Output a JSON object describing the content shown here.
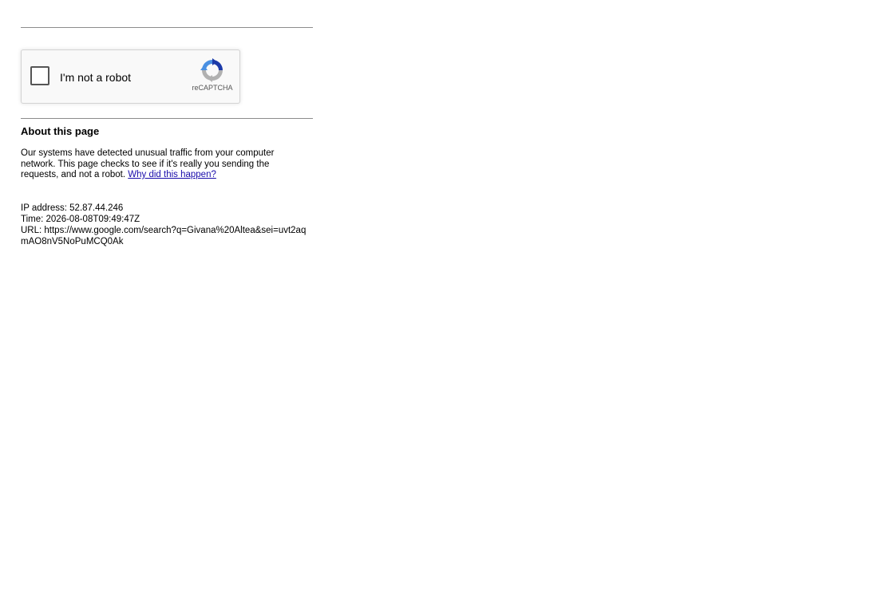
{
  "captcha": {
    "label": "I'm not a robot",
    "brand": "reCAPTCHA",
    "checked": false
  },
  "about": {
    "title": "About this page",
    "body": "Our systems have detected unusual traffic from your computer network. This page checks to see if it's really you sending the requests, and not a robot.",
    "link_text": "Why did this happen?"
  },
  "meta": {
    "ip": "IP address: 52.87.44.246",
    "time": "Time: 2026-08-08T09:49:47Z",
    "url": "URL: https://www.google.com/search?q=Givana%20Altea&sei=uvt2aqmAO8nV5NoPuMCQ0Ak"
  },
  "colors": {
    "link": "#1a0dab",
    "recaptcha_blue": "#1c3aa9",
    "recaptcha_light_blue": "#4a90e2",
    "recaptcha_gray": "#b1b1b1"
  }
}
